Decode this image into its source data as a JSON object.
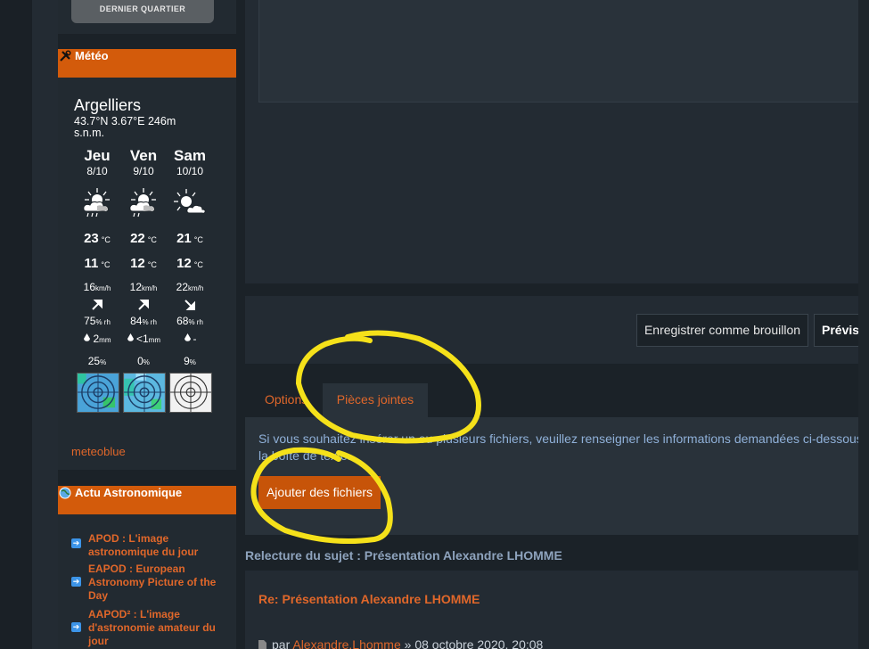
{
  "sidebar": {
    "moon_phase_label": "DERNIER QUARTIER",
    "meteo": {
      "header": "Météo",
      "city": "Argelliers",
      "coords": "43.7°N 3.67°E 246m s.n.m.",
      "days": [
        {
          "name": "Jeu",
          "date": "8/10",
          "icon": "sun-cloud-rain-icon",
          "tmax": "23",
          "tmin": "11",
          "wind": "16",
          "hum": "75",
          "rain": "2",
          "rain_unit": "mm",
          "prob": "25"
        },
        {
          "name": "Ven",
          "date": "9/10",
          "icon": "sun-cloud-rain-icon",
          "tmax": "22",
          "tmin": "12",
          "wind": "12",
          "hum": "84",
          "rain": "<1",
          "rain_unit": "mm",
          "prob": "0"
        },
        {
          "name": "Sam",
          "date": "10/10",
          "icon": "sun-cloud-icon",
          "tmax": "21",
          "tmin": "12",
          "wind": "22",
          "hum": "68",
          "rain": "-",
          "rain_unit": "",
          "prob": "9"
        }
      ],
      "temp_unit": "°C",
      "wind_unit": "km/h",
      "hum_unit": "% rh",
      "prob_unit": "%",
      "link": "meteoblue"
    },
    "astro": {
      "header": "Actu Astronomique",
      "items": [
        {
          "label": "APOD : L'image astronomique du jour"
        },
        {
          "label": "EAPOD : European Astronomy Picture of the Day"
        },
        {
          "label": "AAPOD² : L'image d'astronomie amateur du jour"
        }
      ]
    }
  },
  "main": {
    "btn_draft": "Enregistrer comme brouillon",
    "btn_preview": "Prévisu",
    "tabs": [
      {
        "label": "Options"
      },
      {
        "label": "Pièces jointes"
      }
    ],
    "attach_desc_line1": "Si vous souhaitez insérer un ou plusieurs fichiers, veuillez renseigner les informations demandées ci-dessous",
    "attach_desc_line2": "la boîte de texte.",
    "btn_add_files": "Ajouter des fichiers",
    "review_title": "Relecture du sujet : Présentation Alexandre LHOMME",
    "post_title": "Re: Présentation Alexandre LHOMME",
    "post_by": "par",
    "post_author": "Alexandre.Lhomme",
    "post_date": "» 08 octobre 2020, 20:08"
  },
  "colors": {
    "accent": "#d35b0b",
    "link": "#e0672a",
    "highlight": "#f5e11a"
  }
}
